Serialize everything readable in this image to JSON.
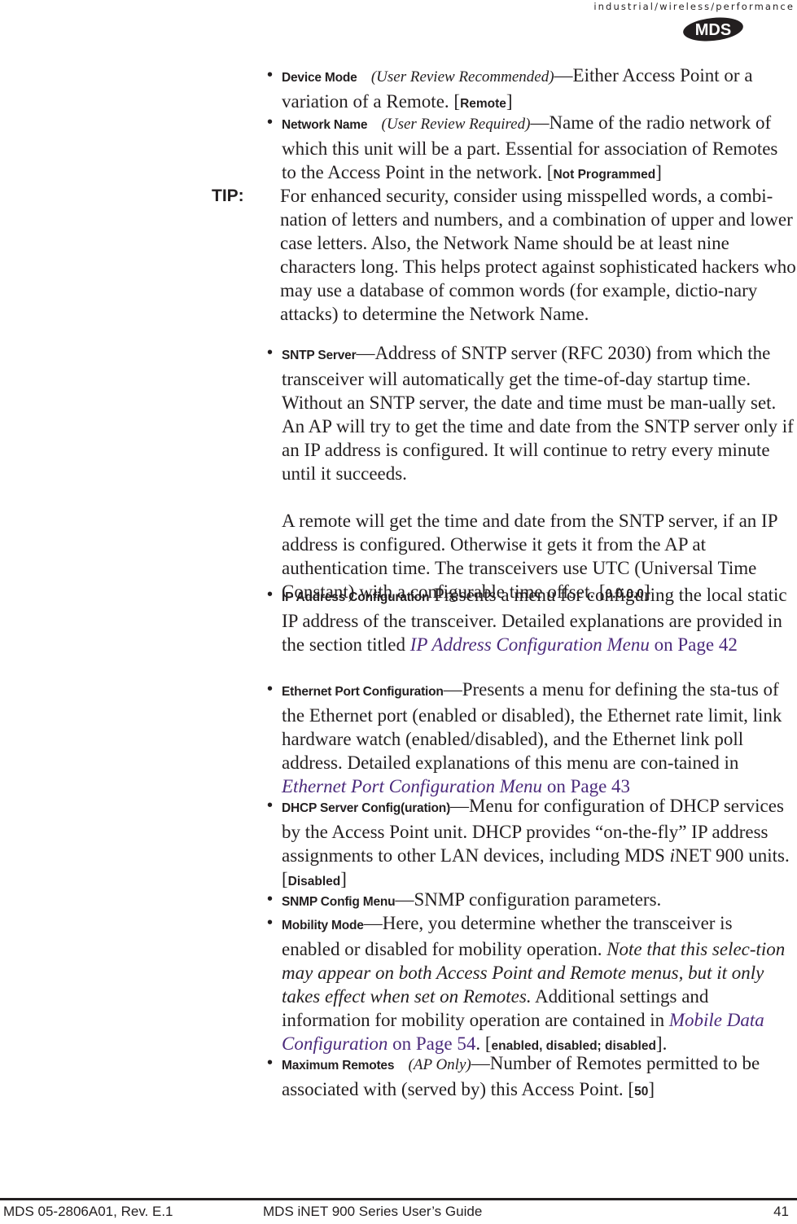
{
  "header": {
    "tagline": "industrial/wireless/performance",
    "logo_text": "MDS"
  },
  "items_top": [
    {
      "term": "Device Mode",
      "note": "(User Review Recommended)",
      "text": "—Either Access Point or a variation of a Remote. [",
      "value": "Remote",
      "close": "]"
    },
    {
      "term": "Network Name",
      "note": "(User Review Required)",
      "text": "—Name of the radio network of which this unit will be a part. Essential for association of Remotes to the Access Point in the network. [",
      "value": "Not Programmed",
      "close": "]"
    }
  ],
  "tip": {
    "label": "TIP:",
    "text": "For enhanced security, consider using misspelled words, a combi-nation of letters and numbers, and a combination of upper and lower case letters. Also, the Network Name should be at least nine characters long. This helps protect against sophisticated hackers who may use a database of common words (for example, dictio-nary attacks) to determine the Network Name."
  },
  "sntp": {
    "term": "SNTP Server",
    "text1": "—Address of SNTP server (RFC 2030) from which the transceiver will automatically get the time-of-day startup time. Without an SNTP server, the date and time must be man-ually set. An AP will try to get the time and date from the SNTP server only if an IP address is configured. It will continue to retry every minute until it succeeds.",
    "text2": "A remote will get the time and date from the SNTP server, if an IP address is configured. Otherwise it gets it from the AP at authentication time. The transceivers use UTC (Universal Time Constant) with a configurable time offset. [",
    "value": "0.0.0.0",
    "close": "]"
  },
  "ipconfig": {
    "term": "IP Address Configuration",
    "text": " Presents a menu for configuring the local static IP address of the transceiver. Detailed explanations are provided in the section titled ",
    "link_title": "IP Address Configuration Menu",
    "link_page": " on Page 42"
  },
  "ethernet": {
    "term": "Ethernet Port Configuration",
    "text": "—Presents a menu for defining the sta-tus of the Ethernet port (enabled or disabled), the Ethernet rate limit, link hardware watch (enabled/disabled), and the Ethernet link poll address. Detailed explanations of this menu are con-tained in ",
    "link_title": "Ethernet Port Configuration Menu",
    "link_page": " on Page 43"
  },
  "dhcp": {
    "term": "DHCP Server Config(uration)",
    "text": "—Menu for configuration of DHCP services by the Access Point unit. DHCP provides “on-the-fly” IP address assignments to other LAN devices, including MDS ",
    "i": "i",
    "text2": "NET 900 units. [",
    "value": "Disabled",
    "close": "]"
  },
  "snmp": {
    "term": "SNMP Config Menu",
    "text": "—SNMP configuration parameters."
  },
  "mobility": {
    "term": "Mobility Mode",
    "text": "—Here, you determine whether the transceiver is enabled or disabled for mobility operation. ",
    "italic": "Note that this selec-tion may appear on both Access Point and Remote menus, but it only takes effect when set on Remotes.",
    "text2": " Additional settings and information for mobility operation are contained in ",
    "link_title": "Mobile Data Configuration",
    "link_page": " on Page 54",
    "text3": ". [",
    "value": "enabled, disabled; disabled",
    "close": "]."
  },
  "maxremotes": {
    "term": "Maximum Remotes",
    "note": "(AP Only)",
    "text": "—Number of Remotes permitted to be associated with (served by) this Access Point. [",
    "value": "50",
    "close": "]"
  },
  "footer": {
    "doc_id": "MDS 05-2806A01, Rev. E.1",
    "title": "MDS iNET 900 Series User’s Guide",
    "page": "41"
  },
  "colors": {
    "link": "#4b2a7b",
    "text": "#231f20"
  }
}
